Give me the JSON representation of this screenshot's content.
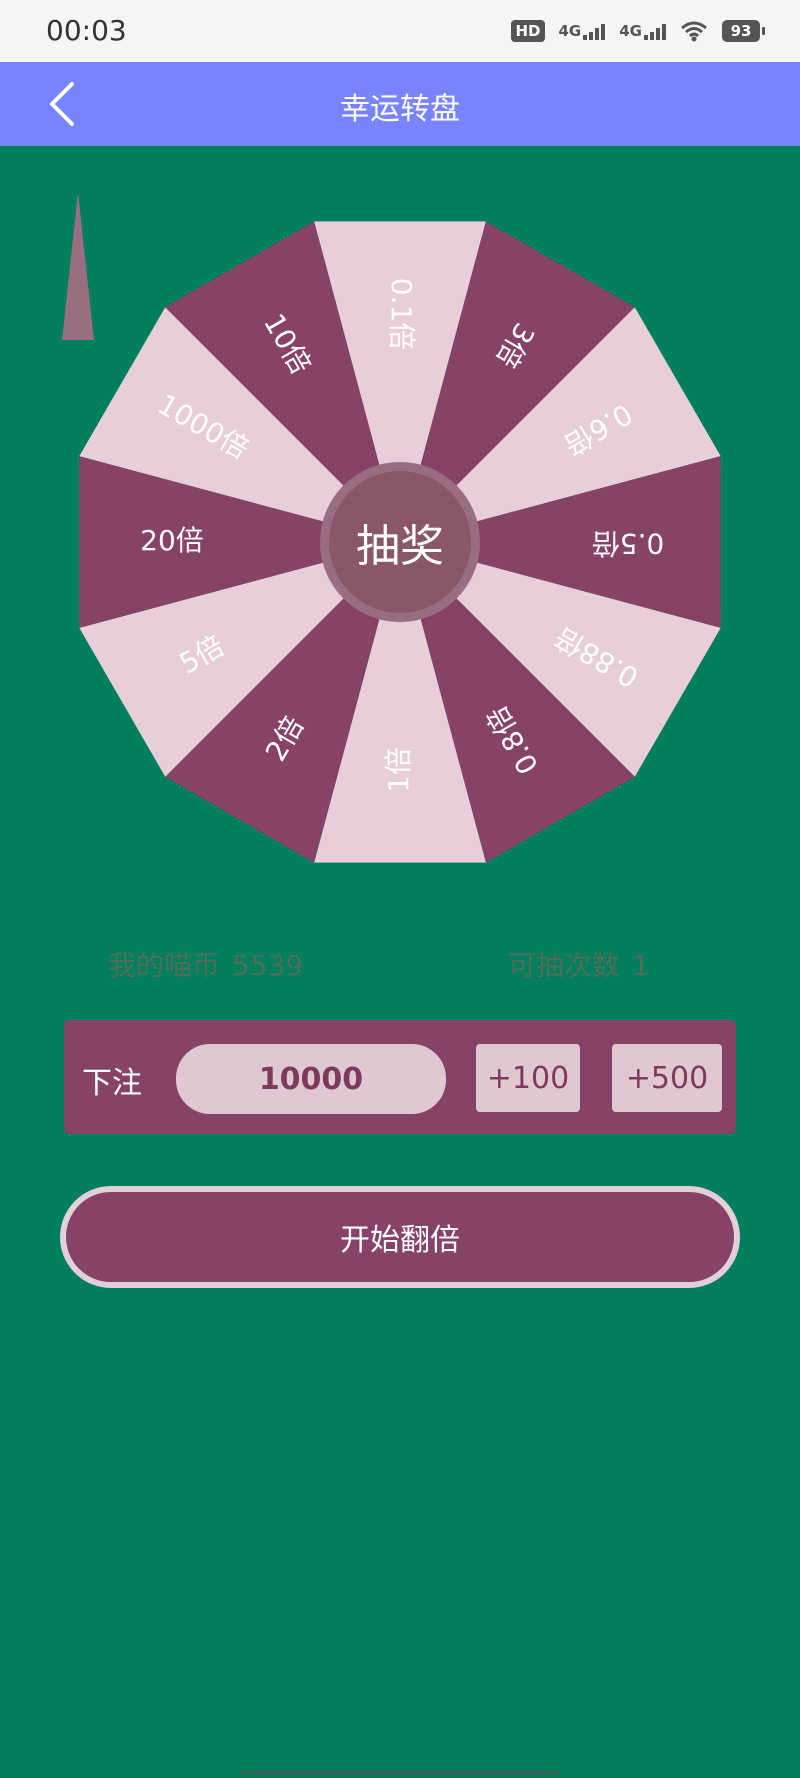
{
  "status_bar": {
    "time": "00:03",
    "hd": "HD",
    "net1": "4G",
    "net2": "4G",
    "battery": "93"
  },
  "app_bar": {
    "title": "幸运转盘",
    "back_icon": "chevron-left-icon"
  },
  "wheel": {
    "segments": [
      "0.1倍",
      "3倍",
      "0.6倍",
      "0.5倍",
      "0.88倍",
      "0.8倍",
      "1倍",
      "2倍",
      "5倍",
      "20倍",
      "1000倍",
      "10倍"
    ],
    "colors": {
      "light": "#e8ced8",
      "dark": "#874267",
      "light_text": "#ffffff",
      "dark_text": "#ffffff"
    },
    "center_label": "抽奖"
  },
  "info": {
    "coins_label": "我的喵币",
    "coins_value": "5539",
    "draws_label": "可抽次数",
    "draws_value": "1"
  },
  "bet": {
    "label": "下注",
    "value": "10000",
    "inc_100": "+100",
    "inc_500": "+500"
  },
  "start_button": {
    "label": "开始翻倍"
  },
  "colors": {
    "background": "#007e5d",
    "app_bar": "#7a83ff",
    "accent": "#874267",
    "light": "#e0c8d3"
  }
}
